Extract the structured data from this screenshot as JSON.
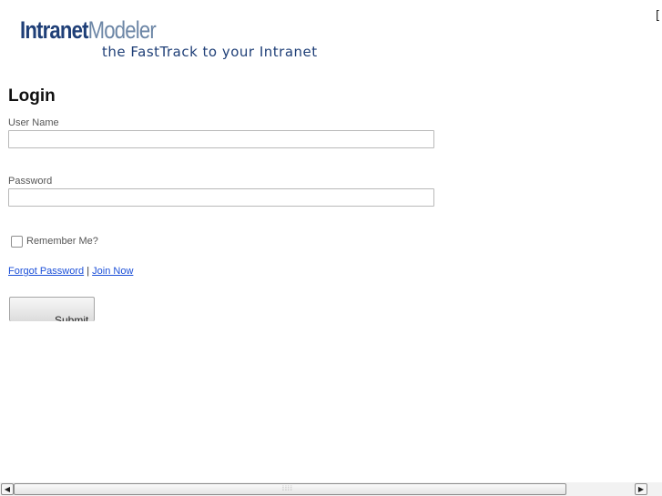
{
  "brand": {
    "logo_part1": "Intranet",
    "logo_part2": "Modeler",
    "tagline": "the FastTrack to your Intranet",
    "primary_color": "#1f3f77",
    "secondary_color": "#6c86a6"
  },
  "corner_glyph": "[",
  "login": {
    "title": "Login",
    "username_label": "User Name",
    "username_value": "",
    "password_label": "Password",
    "password_value": "",
    "remember_label": "Remember Me?",
    "remember_checked": false,
    "forgot_link": "Forgot Password",
    "separator": "|",
    "join_link": "Join Now",
    "submit_label": "Submit"
  },
  "scrollbar": {
    "left_arrow": "◀",
    "right_arrow": "▶",
    "grip": "⁞⁞⁞⁞"
  }
}
